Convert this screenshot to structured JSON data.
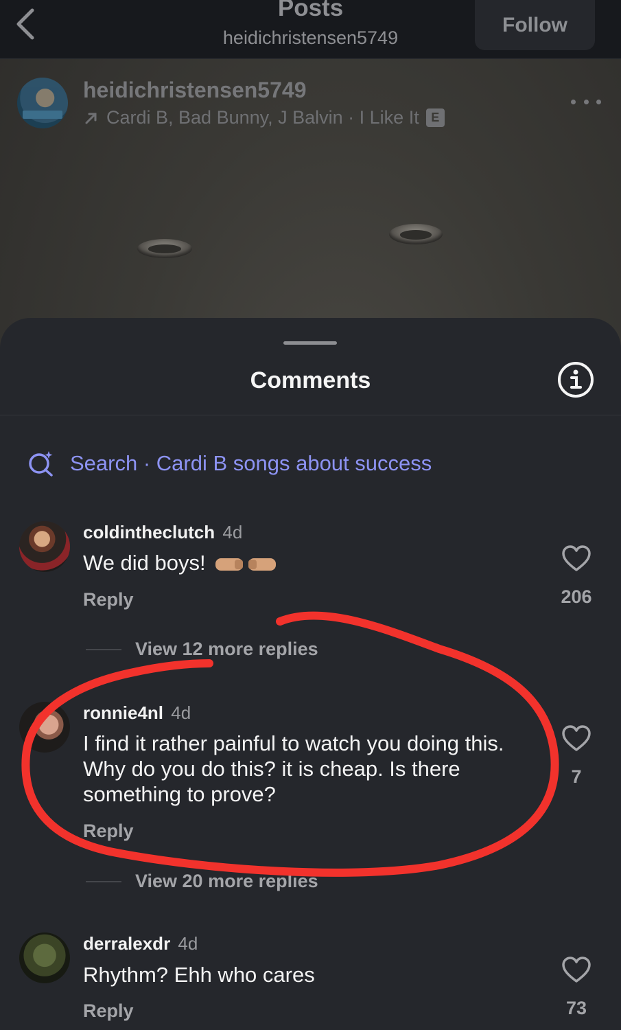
{
  "nav": {
    "title": "Posts",
    "username": "heidichristensen5749",
    "follow_label": "Follow"
  },
  "post": {
    "username": "heidichristensen5749",
    "music": "Cardi B, Bad Bunny, J Balvin · I Like It",
    "explicit": "E"
  },
  "comments_sheet": {
    "title": "Comments",
    "search_label": "Search · Cardi B songs about success",
    "comments": [
      {
        "username": "coldintheclutch",
        "time": "4d",
        "text": "We did boys!",
        "reply_label": "Reply",
        "likes": "206",
        "view_more": "View 12 more replies"
      },
      {
        "username": "ronnie4nl",
        "time": "4d",
        "text": "I find it rather painful to watch you doing this. Why do you do this? it is cheap. Is there something to prove?",
        "reply_label": "Reply",
        "likes": "7",
        "view_more": "View 20 more replies"
      },
      {
        "username": "derralexdr",
        "time": "4d",
        "text": "Rhythm? Ehh who cares",
        "reply_label": "Reply",
        "likes": "73"
      }
    ]
  },
  "colors": {
    "sheet": "#25272c",
    "accent_search": "#8d93f3",
    "annotation_red": "#f2322c"
  },
  "icons": [
    "back-chevron-icon",
    "more-icon",
    "info-icon",
    "ai-search-icon",
    "heart-icon",
    "fist-bump-emoji"
  ]
}
